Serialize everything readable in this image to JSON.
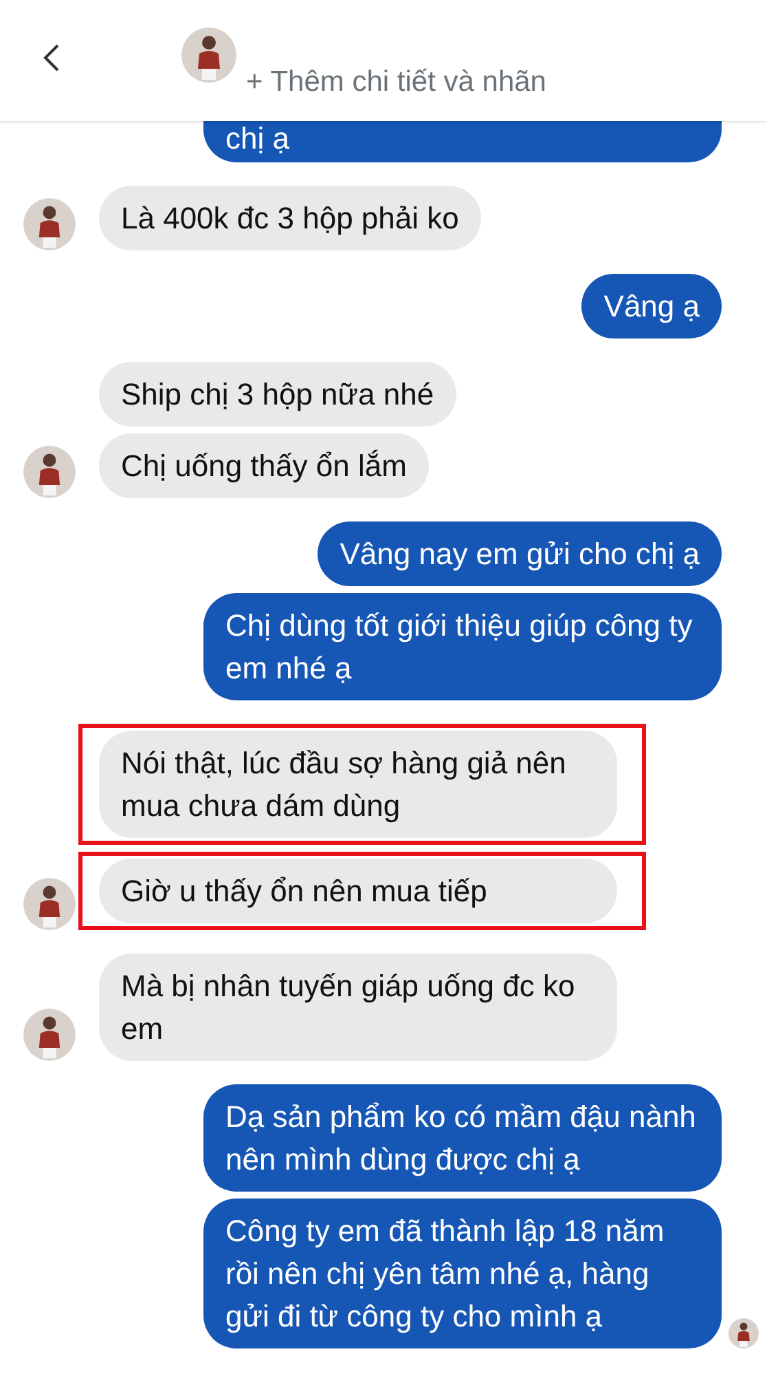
{
  "header": {
    "subtitle": "+ Thêm chi tiết và nhãn"
  },
  "groups": [
    {
      "kind": "out",
      "seen": false,
      "messages": [
        {
          "text": "chị ạ",
          "highlighted": false
        }
      ]
    },
    {
      "kind": "in",
      "messages": [
        {
          "text": "Là 400k đc 3 hộp phải ko",
          "highlighted": false
        }
      ]
    },
    {
      "kind": "out",
      "seen": false,
      "messages": [
        {
          "text": "Vâng ạ",
          "highlighted": false
        }
      ]
    },
    {
      "kind": "in",
      "messages": [
        {
          "text": "Ship chị 3 hộp nữa nhé",
          "highlighted": false
        },
        {
          "text": "Chị uống thấy ổn lắm",
          "highlighted": false
        }
      ]
    },
    {
      "kind": "out",
      "seen": false,
      "messages": [
        {
          "text": "Vâng nay em gửi cho chị ạ",
          "highlighted": false
        },
        {
          "text": "Chị dùng tốt giới thiệu giúp công ty em nhé ạ",
          "highlighted": false
        }
      ]
    },
    {
      "kind": "in",
      "messages": [
        {
          "text": "Nói thật, lúc đầu sợ hàng giả nên mua chưa dám dùng",
          "highlighted": true
        },
        {
          "text": "Giờ u thấy ổn nên mua tiếp",
          "highlighted": true
        }
      ]
    },
    {
      "kind": "in",
      "messages": [
        {
          "text": "Mà bị nhân tuyến giáp uống đc ko em",
          "highlighted": false
        }
      ]
    },
    {
      "kind": "out",
      "seen": true,
      "messages": [
        {
          "text": "Dạ sản phẩm ko có mầm đậu nành nên mình dùng được chị ạ",
          "highlighted": false
        },
        {
          "text": "Công ty em đã thành lập 18 năm rồi nên chị yên tâm nhé ạ, hàng gửi đi từ công ty cho mình ạ",
          "highlighted": false
        }
      ]
    }
  ]
}
